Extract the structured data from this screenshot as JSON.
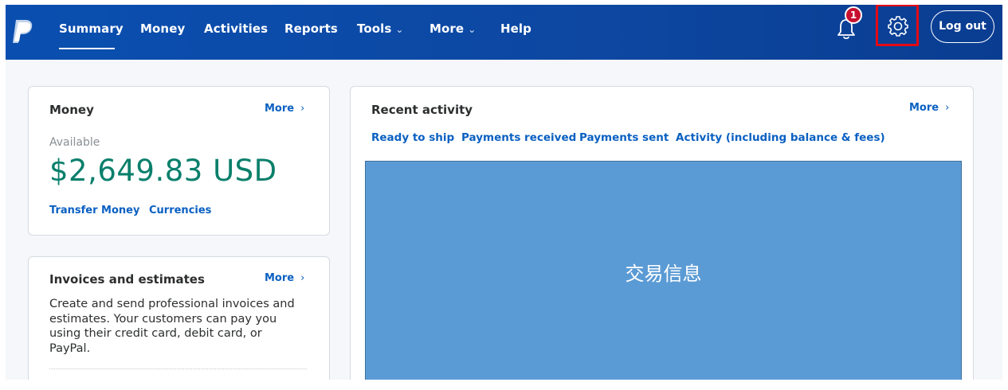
{
  "nav": {
    "items": [
      "Summary",
      "Money",
      "Activities",
      "Reports",
      "Tools",
      "More",
      "Help"
    ],
    "notification_count": "1",
    "logout_label": "Log out"
  },
  "money_card": {
    "title": "Money",
    "more_label": "More",
    "available_label": "Available",
    "balance": "$2,649.83 USD",
    "transfer_label": "Transfer Money",
    "separator": "·",
    "currencies_label": "Currencies"
  },
  "invoices_card": {
    "title": "Invoices and estimates",
    "more_label": "More",
    "description": "Create and send professional invoices and estimates. Your customers can pay you using their credit card, debit card, or PayPal."
  },
  "activity_card": {
    "title": "Recent activity",
    "more_label": "More",
    "tabs": [
      "Ready to ship",
      "Payments received",
      "Payments sent",
      "Activity (including balance & fees)"
    ],
    "placeholder_text": "交易信息"
  },
  "colors": {
    "nav_bg": "#0d47a1",
    "balance": "#0a7f6b",
    "link": "#0a60c2",
    "badge": "#c8102e",
    "highlight": "#e50914",
    "placeholder": "#5b9bd5"
  },
  "icons": [
    "paypal-logo",
    "bell-icon",
    "gear-icon",
    "chevron-down-icon",
    "chevron-right-icon"
  ]
}
